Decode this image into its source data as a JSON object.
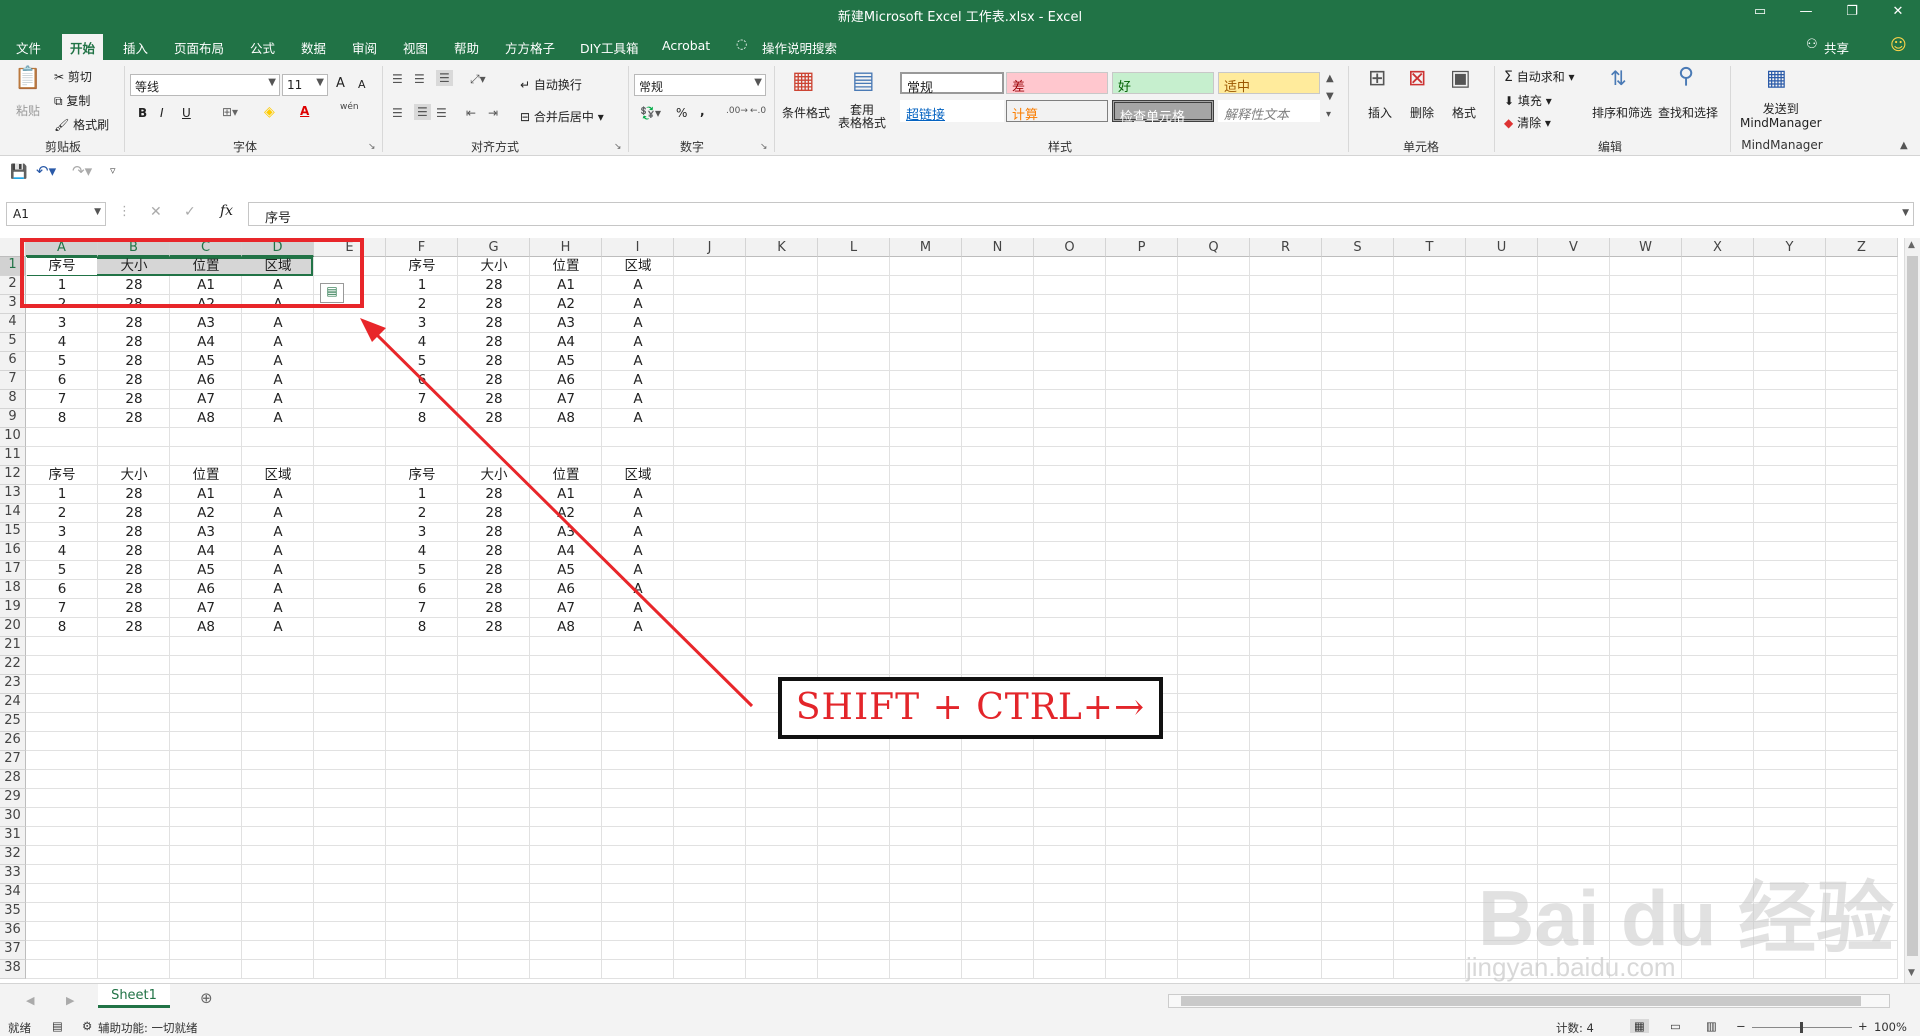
{
  "window": {
    "title": "新建Microsoft Excel 工作表.xlsx  -  Excel"
  },
  "tabs": [
    "文件",
    "开始",
    "插入",
    "页面布局",
    "公式",
    "数据",
    "审阅",
    "视图",
    "帮助",
    "方方格子",
    "DIY工具箱",
    "Acrobat"
  ],
  "tell_me": "操作说明搜索",
  "share": "共享",
  "ribbon": {
    "clipboard": {
      "cut": "剪切",
      "copy": "复制",
      "format_painter": "格式刷",
      "paste": "粘贴",
      "label": "剪贴板"
    },
    "font": {
      "name": "等线",
      "size": "11",
      "label": "字体",
      "bold": "B",
      "italic": "I",
      "underline": "U",
      "grow": "A",
      "shrink": "A",
      "font_color": "A",
      "phonetic": "wén"
    },
    "alignment": {
      "wrap": "自动换行",
      "merge": "合并后居中",
      "label": "对齐方式"
    },
    "number": {
      "format": "常规",
      "percent": "%",
      "comma": ",",
      "label": "数字"
    },
    "styles": {
      "conditional": "条件格式",
      "format_table": "套用\n表格格式",
      "cells": [
        "常规",
        "差",
        "好",
        "适中",
        "超链接",
        "计算",
        "检查单元格",
        "解释性文本"
      ],
      "label": "样式"
    },
    "cells": {
      "insert": "插入",
      "delete": "删除",
      "format": "格式",
      "label": "单元格"
    },
    "editing": {
      "autosum": "自动求和",
      "fill": "填充",
      "clear": "清除",
      "sort": "排序和筛选",
      "find": "查找和选择",
      "label": "编辑"
    },
    "mindmanager": {
      "send": "发送到\nMindManager",
      "label": "MindManager"
    }
  },
  "formula_bar": {
    "name_box": "A1",
    "fx": "fx",
    "content": "序号"
  },
  "columns": [
    "A",
    "B",
    "C",
    "D",
    "E",
    "F",
    "G",
    "H",
    "I",
    "J",
    "K",
    "L",
    "M",
    "N",
    "O",
    "P",
    "Q",
    "R",
    "S",
    "T",
    "U",
    "V",
    "W",
    "X",
    "Y",
    "Z"
  ],
  "rows": [
    "1",
    "2",
    "3",
    "4",
    "5",
    "6",
    "7",
    "8",
    "9",
    "10",
    "11",
    "12",
    "13",
    "14",
    "15",
    "16",
    "17",
    "18",
    "19",
    "20",
    "21",
    "22",
    "23",
    "24",
    "25",
    "26",
    "27",
    "28",
    "29",
    "30",
    "31",
    "32",
    "33",
    "34",
    "35",
    "36",
    "37",
    "38"
  ],
  "table": {
    "headers": [
      "序号",
      "大小",
      "位置",
      "区域"
    ],
    "rows": [
      [
        "1",
        "28",
        "A1",
        "A"
      ],
      [
        "2",
        "28",
        "A2",
        "A"
      ],
      [
        "3",
        "28",
        "A3",
        "A"
      ],
      [
        "4",
        "28",
        "A4",
        "A"
      ],
      [
        "5",
        "28",
        "A5",
        "A"
      ],
      [
        "6",
        "28",
        "A6",
        "A"
      ],
      [
        "7",
        "28",
        "A7",
        "A"
      ],
      [
        "8",
        "28",
        "A8",
        "A"
      ]
    ]
  },
  "sheet_tabs": [
    "Sheet1"
  ],
  "status": {
    "ready": "就绪",
    "accessibility": "辅助功能: 一切就绪",
    "count": "计数: 4",
    "zoom": "100%"
  },
  "annotation": {
    "shortcut": "SHIFT + CTRL+→"
  },
  "watermark": {
    "line1": "Bai du 经验",
    "line2": "jingyan.baidu.com"
  },
  "colors": {
    "excel_green": "#217346",
    "annotation_red": "#e8262a"
  }
}
